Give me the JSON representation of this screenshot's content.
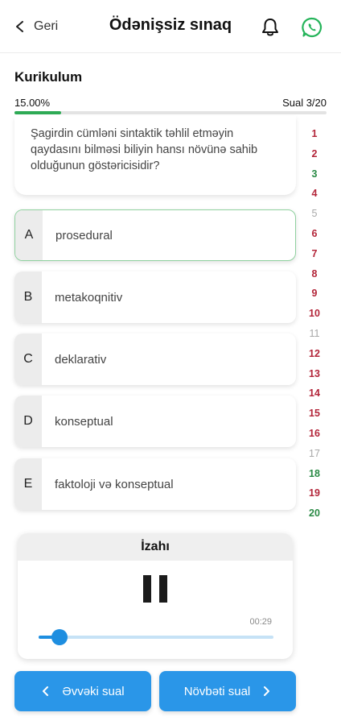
{
  "header": {
    "back_label": "Geri",
    "title": "Ödənişsiz sınaq"
  },
  "section": {
    "title": "Kurikulum",
    "progress_label": "15.00%",
    "progress_value": 0.15,
    "question_counter": "Sual 3/20"
  },
  "question": {
    "text": "Şagirdin cümləni sintaktik təhlil etməyin qaydasını bilməsi biliyin hansı növünə sahib olduğunun göstəricisidir?"
  },
  "options": [
    {
      "letter": "A",
      "text": "prosedural",
      "selected": true
    },
    {
      "letter": "B",
      "text": "metakoqnitiv",
      "selected": false
    },
    {
      "letter": "C",
      "text": "deklarativ",
      "selected": false
    },
    {
      "letter": "D",
      "text": "konseptual",
      "selected": false
    },
    {
      "letter": "E",
      "text": "faktoloji və konseptual",
      "selected": false
    }
  ],
  "question_numbers": [
    {
      "n": "1",
      "status": "red"
    },
    {
      "n": "2",
      "status": "red"
    },
    {
      "n": "3",
      "status": "green"
    },
    {
      "n": "4",
      "status": "red"
    },
    {
      "n": "5",
      "status": "gray"
    },
    {
      "n": "6",
      "status": "red"
    },
    {
      "n": "7",
      "status": "red"
    },
    {
      "n": "8",
      "status": "red"
    },
    {
      "n": "9",
      "status": "red"
    },
    {
      "n": "10",
      "status": "red"
    },
    {
      "n": "11",
      "status": "gray"
    },
    {
      "n": "12",
      "status": "red"
    },
    {
      "n": "13",
      "status": "red"
    },
    {
      "n": "14",
      "status": "red"
    },
    {
      "n": "15",
      "status": "red"
    },
    {
      "n": "16",
      "status": "red"
    },
    {
      "n": "17",
      "status": "gray"
    },
    {
      "n": "18",
      "status": "green"
    },
    {
      "n": "19",
      "status": "red"
    },
    {
      "n": "20",
      "status": "green"
    }
  ],
  "explanation": {
    "title": "İzahı",
    "time": "00:29",
    "played_fraction": 0.09
  },
  "nav": {
    "prev_label": "Əvvəki sual",
    "next_label": "Növbəti sual"
  },
  "colors": {
    "accent_blue": "#2a96e8",
    "progress_green": "#2eaa55",
    "wrong_red": "#b3263a",
    "right_green": "#2a8a45",
    "whatsapp_green": "#25b45a"
  },
  "icons": {
    "back": "chevron-left-icon",
    "bell": "bell-icon",
    "whatsapp": "whatsapp-icon",
    "pause": "pause-icon",
    "prev": "chevron-left-icon",
    "next": "chevron-right-icon"
  }
}
